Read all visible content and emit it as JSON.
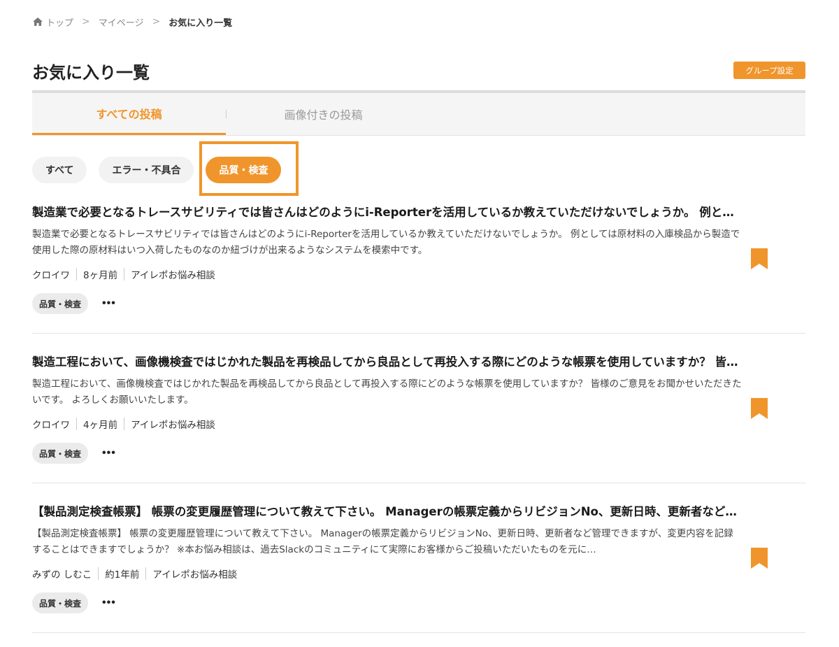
{
  "breadcrumb": {
    "home": "トップ",
    "mypage": "マイページ",
    "current": "お気に入り一覧",
    "separator": ">"
  },
  "page": {
    "title": "お気に入り一覧",
    "group_settings_label": "グループ設定"
  },
  "tabs": [
    {
      "label": "すべての投稿",
      "active": true
    },
    {
      "label": "画像付きの投稿",
      "active": false
    }
  ],
  "filters": [
    {
      "label": "すべて",
      "active": false
    },
    {
      "label": "エラー・不具合",
      "active": false
    },
    {
      "label": "品質・検査",
      "active": true
    }
  ],
  "posts": [
    {
      "title": "製造業で必要となるトレースサビリティでは皆さんはどのようにi-Reporterを活用しているか教えていただけないでしょうか。 例としては原材料の入庫検品から製造で使用した際の原材料はいつ入荷したものなのか紐づけが出来るようなシステムを模索中です。",
      "excerpt": "製造業で必要となるトレースサビリティでは皆さんはどのようにi-Reporterを活用しているか教えていただけないでしょうか。 例としては原材料の入庫検品から製造で使用した際の原材料はいつ入荷したものなのか紐づけが出来るようなシステムを模索中です。",
      "author": "クロイワ",
      "time": "8ヶ月前",
      "category": "アイレポお悩み相談",
      "tag": "品質・検査",
      "more": "•••"
    },
    {
      "title": "製造工程において、画像機検査ではじかれた製品を再検品してから良品として再投入する際にどのような帳票を使用していますか？ 皆様のご意見をお聞かせいただきたいです。",
      "excerpt": "製造工程において、画像機検査ではじかれた製品を再検品してから良品として再投入する際にどのような帳票を使用していますか？ 皆様のご意見をお聞かせいただきたいです。 よろしくお願いいたします。",
      "author": "クロイワ",
      "time": "4ヶ月前",
      "category": "アイレポお悩み相談",
      "tag": "品質・検査",
      "more": "•••"
    },
    {
      "title": "【製品測定検査帳票】 帳票の変更履歴管理について教えて下さい。 Managerの帳票定義からリビジョンNo、更新日時、更新者など管理できますが、変更内容を記録することはできますでしょうか？",
      "excerpt": "【製品測定検査帳票】 帳票の変更履歴管理について教えて下さい。 Managerの帳票定義からリビジョンNo、更新日時、更新者など管理できますが、変更内容を記録することはできますでしょうか？ ※本お悩み相談は、過去Slackのコミュニティにて実際にお客様からご投稿いただいたものを元に…",
      "author": "みずの しむこ",
      "time": "約1年前",
      "category": "アイレポお悩み相談",
      "tag": "品質・検査",
      "more": "•••"
    }
  ],
  "colors": {
    "accent": "#f0952b",
    "bookmark": "#f0952b"
  }
}
